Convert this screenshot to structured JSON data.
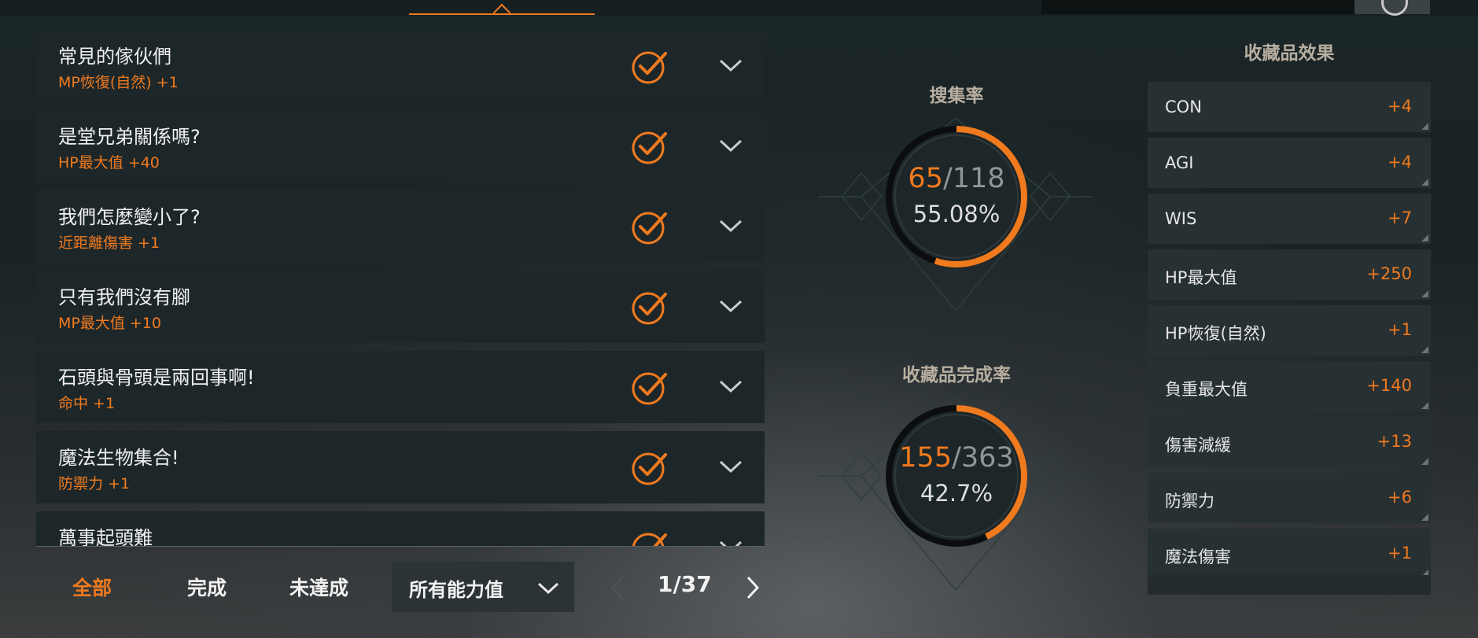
{
  "collections": [
    {
      "title": "常見的傢伙們",
      "effect": "MP恢復(自然)  +1"
    },
    {
      "title": "是堂兄弟關係嗎?",
      "effect": "HP最大值  +40"
    },
    {
      "title": "我們怎麼變小了?",
      "effect": "近距離傷害  +1"
    },
    {
      "title": "只有我們沒有腳",
      "effect": "MP最大值  +10"
    },
    {
      "title": "石頭與骨頭是兩回事啊!",
      "effect": "命中  +1"
    },
    {
      "title": "魔法生物集合!",
      "effect": "防禦力  +1"
    },
    {
      "title": "萬事起頭難",
      "effect": ""
    }
  ],
  "filters": {
    "all": "全部",
    "complete": "完成",
    "incomplete": "未達成",
    "ability_dropdown": "所有能力值"
  },
  "pager": {
    "text": "1/37",
    "current": 1,
    "total": 37
  },
  "gather_rate": {
    "title": "搜集率",
    "current": "65",
    "total": "/118",
    "percent": "55.08%",
    "fraction": 0.5508
  },
  "completion_rate": {
    "title": "收藏品完成率",
    "current": "155",
    "total": "/363",
    "percent": "42.7%",
    "fraction": 0.427
  },
  "effects": {
    "title": "收藏品效果",
    "items": [
      {
        "name": "CON",
        "value": "+4"
      },
      {
        "name": "AGI",
        "value": "+4"
      },
      {
        "name": "WIS",
        "value": "+7"
      },
      {
        "name": "HP最大值",
        "value": "+250"
      },
      {
        "name": "HP恢復(自然)",
        "value": "+1"
      },
      {
        "name": "負重最大值",
        "value": "+140"
      },
      {
        "name": "傷害減緩",
        "value": "+13"
      },
      {
        "name": "防禦力",
        "value": "+6"
      },
      {
        "name": "魔法傷害",
        "value": "+1"
      }
    ]
  },
  "colors": {
    "accent": "#f07a1e",
    "panel": "#1d272a",
    "effect_panel": "#273033"
  },
  "icons": [
    "check-circle-icon",
    "chevron-down-icon",
    "chevron-left-icon",
    "chevron-right-icon"
  ]
}
